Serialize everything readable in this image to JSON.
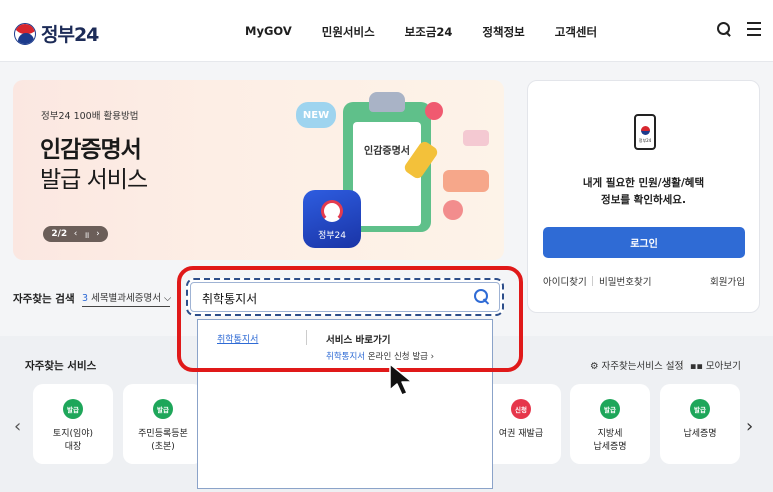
{
  "header": {
    "logo_text": "정부24",
    "nav": [
      "MyGOV",
      "민원서비스",
      "보조금24",
      "정책정보",
      "고객센터"
    ]
  },
  "banner": {
    "subtitle": "정부24 100배 활용방법",
    "title_line1": "인감증명서",
    "title_line2": "발급 서비스",
    "pager": "2/2",
    "new_badge": "NEW",
    "doc_label": "인감증명서",
    "app_label": "정부24"
  },
  "login": {
    "icon_label": "정부24",
    "message_line1": "내게 필요한 민원/생활/혜택",
    "message_line2": "정보를 확인하세요.",
    "button": "로그인",
    "find_id": "아이디찾기",
    "find_pw": "비밀번호찾기",
    "signup": "회원가입"
  },
  "search": {
    "label": "자주찾는 검색",
    "select_number": "3",
    "select_text": "세목별과세증명서",
    "value": "취학통지서",
    "dropdown": {
      "keyword": "취학통지서",
      "shortcut_header": "서비스 바로가기",
      "link_highlight": "취학통지서",
      "link_rest": " 온라인 신청 발급 ›"
    }
  },
  "services": {
    "title": "자주찾는 서비스",
    "settings": "자주찾는서비스 설정",
    "view_all": "모아보기",
    "cards": [
      {
        "badge": "발급",
        "label1": "토지(임야)",
        "label2": "대장",
        "badge_color": "#1ea65a"
      },
      {
        "badge": "발급",
        "label1": "주민등록등본",
        "label2": "(초본)",
        "badge_color": "#1ea65a"
      },
      {
        "badge": "신청",
        "label1": "여권 재발급",
        "label2": "",
        "badge_color": "#e6364b"
      },
      {
        "badge": "발급",
        "label1": "지방세",
        "label2": "납세증명",
        "badge_color": "#1ea65a"
      },
      {
        "badge": "발급",
        "label1": "납세증명",
        "label2": "",
        "badge_color": "#1ea65a"
      }
    ]
  },
  "colors": {
    "brand_blue": "#2f6bd5",
    "highlight_red": "#e01919"
  }
}
